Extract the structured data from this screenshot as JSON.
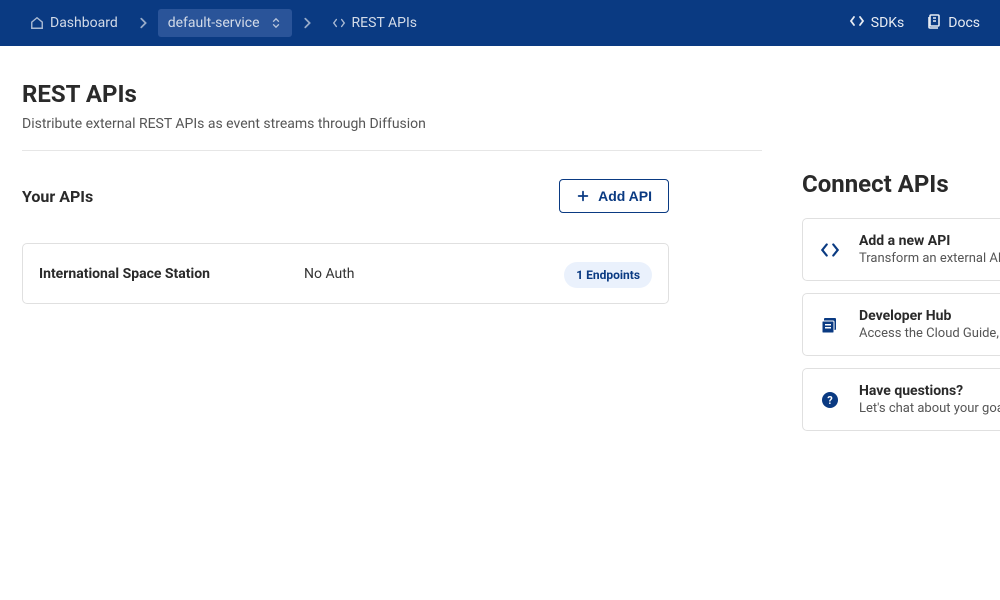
{
  "topbar": {
    "breadcrumbs": [
      {
        "label": "Dashboard"
      },
      {
        "label": "default-service"
      },
      {
        "label": "REST APIs"
      }
    ],
    "actions": {
      "sdks": "SDKs",
      "docs": "Docs"
    }
  },
  "page": {
    "title": "REST APIs",
    "subtitle": "Distribute external REST APIs as event streams through Diffusion"
  },
  "apis": {
    "section_title": "Your APIs",
    "add_button": "Add API",
    "items": [
      {
        "name": "International Space Station",
        "auth": "No Auth",
        "endpoints_badge": "1 Endpoints"
      }
    ]
  },
  "connect": {
    "title": "Connect APIs",
    "cards": [
      {
        "title": "Add a new API",
        "desc": "Transform an external API into a topic stream"
      },
      {
        "title": "Developer Hub",
        "desc": "Access the Cloud Guide, Tutorials and more"
      },
      {
        "title": "Have questions?",
        "desc": "Let's chat about your goals and how we can help"
      }
    ]
  }
}
